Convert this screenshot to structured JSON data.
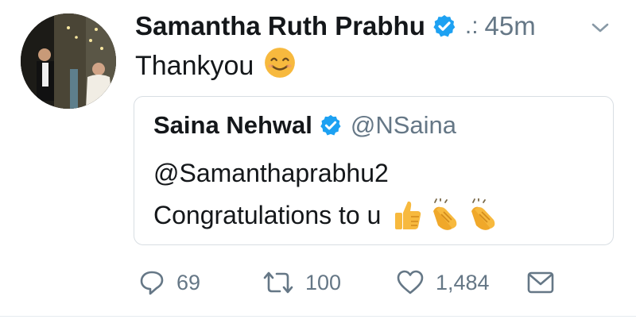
{
  "tweet": {
    "author_name": "Samantha Ruth Prabhu",
    "dots": ".:",
    "time": "45m",
    "text": "Thankyou"
  },
  "quote": {
    "author_name": "Saina Nehwal",
    "handle": "@NSaina",
    "line1": "@Samanthaprabhu2",
    "line2": "Congratulations to u"
  },
  "actions": {
    "replies": "69",
    "retweets": "100",
    "likes": "1,484"
  },
  "icons": {
    "verified": "verified-badge-icon",
    "chevron": "chevron-down-icon",
    "reply": "reply-icon",
    "retweet": "retweet-icon",
    "like": "heart-icon",
    "dm": "envelope-icon",
    "smile": "smiling-face-emoji",
    "thumbs": "thumbs-up-emoji",
    "clap": "clapping-hands-emoji"
  },
  "colors": {
    "verified": "#1da1f2",
    "secondary_text": "#657786",
    "border": "#d8dee3",
    "emoji": "#f7b93e"
  }
}
